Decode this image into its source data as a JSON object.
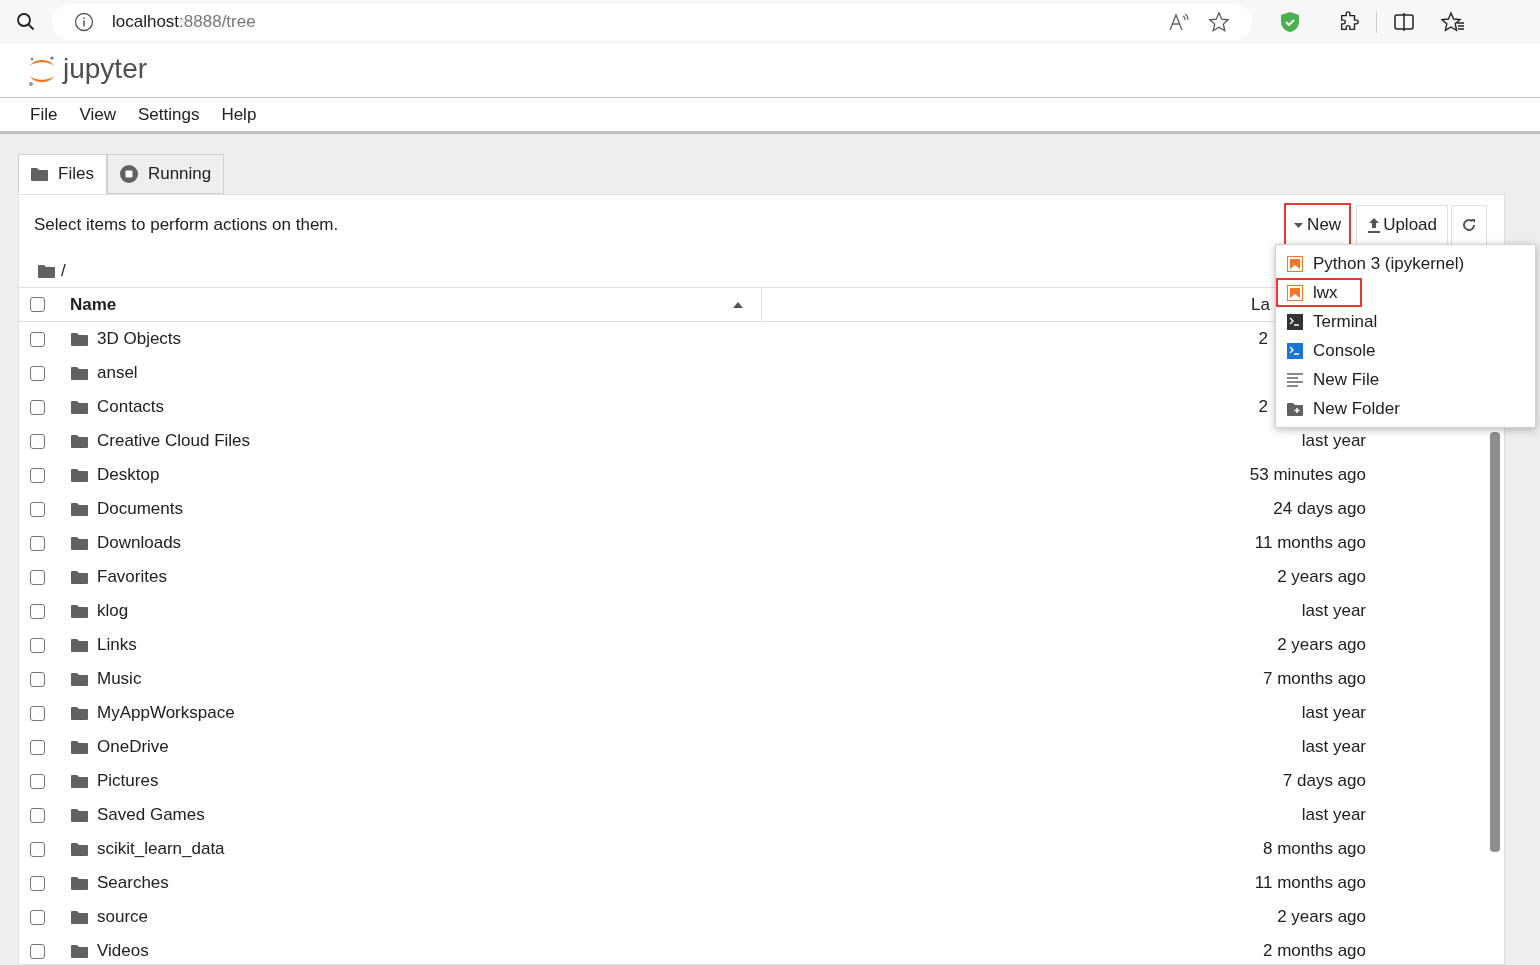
{
  "browser": {
    "url_host": "localhost",
    "url_path": ":8888/tree"
  },
  "app": {
    "logo_text": "jupyter"
  },
  "menu": [
    "File",
    "View",
    "Settings",
    "Help"
  ],
  "tabs": [
    {
      "label": "Files",
      "selected": true,
      "kind": "folder"
    },
    {
      "label": "Running",
      "selected": false,
      "kind": "stop"
    }
  ],
  "hint": "Select items to perform actions on them.",
  "toolbar": {
    "new_button": {
      "label": "New",
      "highlighted": true
    },
    "upload_button": {
      "label": "Upload"
    }
  },
  "breadcrumb": "/",
  "table": {
    "columns": [
      {
        "label": "Name",
        "sorted": true
      },
      {
        "label": "La"
      }
    ],
    "select_all_checked": false,
    "rows": [
      {
        "name": "3D Objects",
        "modified": "2",
        "cut": true,
        "checked": false
      },
      {
        "name": "ansel",
        "checked": false
      },
      {
        "name": "Contacts",
        "modified": "2",
        "cut": true,
        "checked": false
      },
      {
        "name": "Creative Cloud Files",
        "modified": "last year",
        "checked": false
      },
      {
        "name": "Desktop",
        "modified": "53 minutes ago",
        "checked": false
      },
      {
        "name": "Documents",
        "modified": "24 days ago",
        "checked": false
      },
      {
        "name": "Downloads",
        "modified": "11 months ago",
        "checked": false
      },
      {
        "name": "Favorites",
        "modified": "2 years ago",
        "checked": false
      },
      {
        "name": "klog",
        "modified": "last year",
        "checked": false
      },
      {
        "name": "Links",
        "modified": "2 years ago",
        "checked": false
      },
      {
        "name": "Music",
        "modified": "7 months ago",
        "checked": false
      },
      {
        "name": "MyAppWorkspace",
        "modified": "last year",
        "checked": false
      },
      {
        "name": "OneDrive",
        "modified": "last year",
        "checked": false
      },
      {
        "name": "Pictures",
        "modified": "7 days ago",
        "checked": false
      },
      {
        "name": "Saved Games",
        "modified": "last year",
        "checked": false
      },
      {
        "name": "scikit_learn_data",
        "modified": "8 months ago",
        "checked": false
      },
      {
        "name": "Searches",
        "modified": "11 months ago",
        "checked": false
      },
      {
        "name": "source",
        "modified": "2 years ago",
        "checked": false
      },
      {
        "name": "Videos",
        "modified": "2 months ago",
        "checked": false
      }
    ]
  },
  "new_menu": [
    {
      "label": "Python 3 (ipykernel)",
      "kind": "notebook",
      "highlighted": false
    },
    {
      "label": "lwx",
      "kind": "notebook",
      "highlighted": true
    },
    {
      "label": "Terminal",
      "kind": "terminal",
      "highlighted": false
    },
    {
      "label": "Console",
      "kind": "console",
      "highlighted": false
    },
    {
      "label": "New File",
      "kind": "file",
      "highlighted": false
    },
    {
      "label": "New Folder",
      "kind": "folder",
      "highlighted": false
    }
  ]
}
